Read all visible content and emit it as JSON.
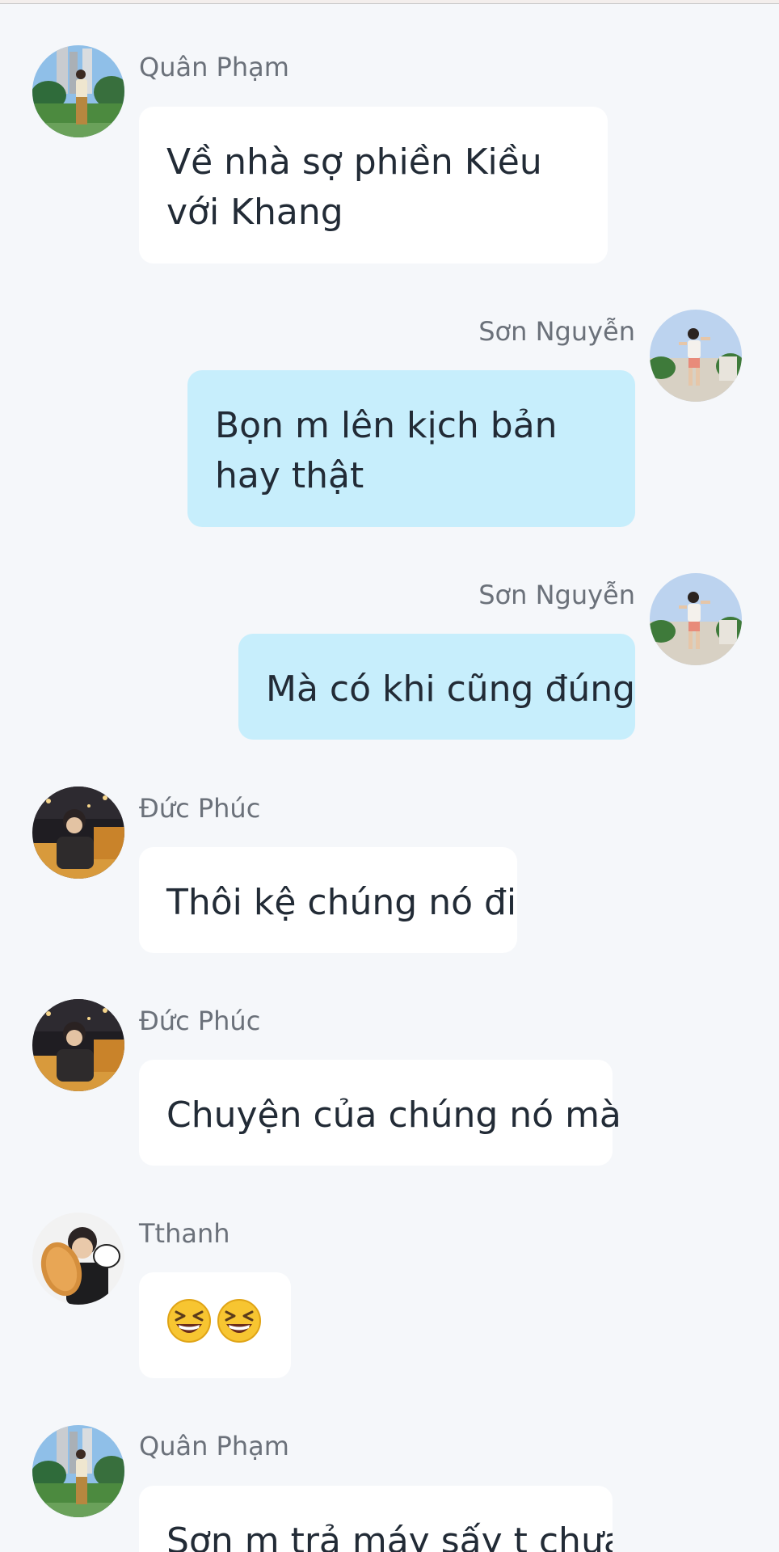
{
  "messages": [
    {
      "sender": "Quân Phạm",
      "avatar": "avatar-quan",
      "side": "incoming",
      "text": "Về nhà sợ phiền Kiều\nvới Khang"
    },
    {
      "sender": "Sơn Nguyễn",
      "avatar": "avatar-son",
      "side": "outgoing",
      "text": "Bọn m lên kịch bản\nhay thật"
    },
    {
      "sender": "Sơn Nguyễn",
      "avatar": "avatar-son",
      "side": "outgoing",
      "text": "Mà có khi cũng đúng"
    },
    {
      "sender": "Đức Phúc",
      "avatar": "avatar-phuc",
      "side": "incoming",
      "text": "Thôi kệ chúng nó đi"
    },
    {
      "sender": "Đức Phúc",
      "avatar": "avatar-phuc",
      "side": "incoming",
      "text": "Chuyện của chúng nó mà"
    },
    {
      "sender": "Tthanh",
      "avatar": "avatar-tthanh",
      "side": "incoming",
      "emojis": [
        "laughing-face-icon",
        "laughing-face-icon"
      ]
    },
    {
      "sender": "Quân Phạm",
      "avatar": "avatar-quan",
      "side": "incoming",
      "text": "Sơn m trả máy sấy t chưa"
    }
  ],
  "colors": {
    "background": "#f5f7fa",
    "incoming_bubble": "#ffffff",
    "outgoing_bubble": "#c7eefc",
    "sender_name": "#6b717a",
    "message_text": "#222b36"
  }
}
